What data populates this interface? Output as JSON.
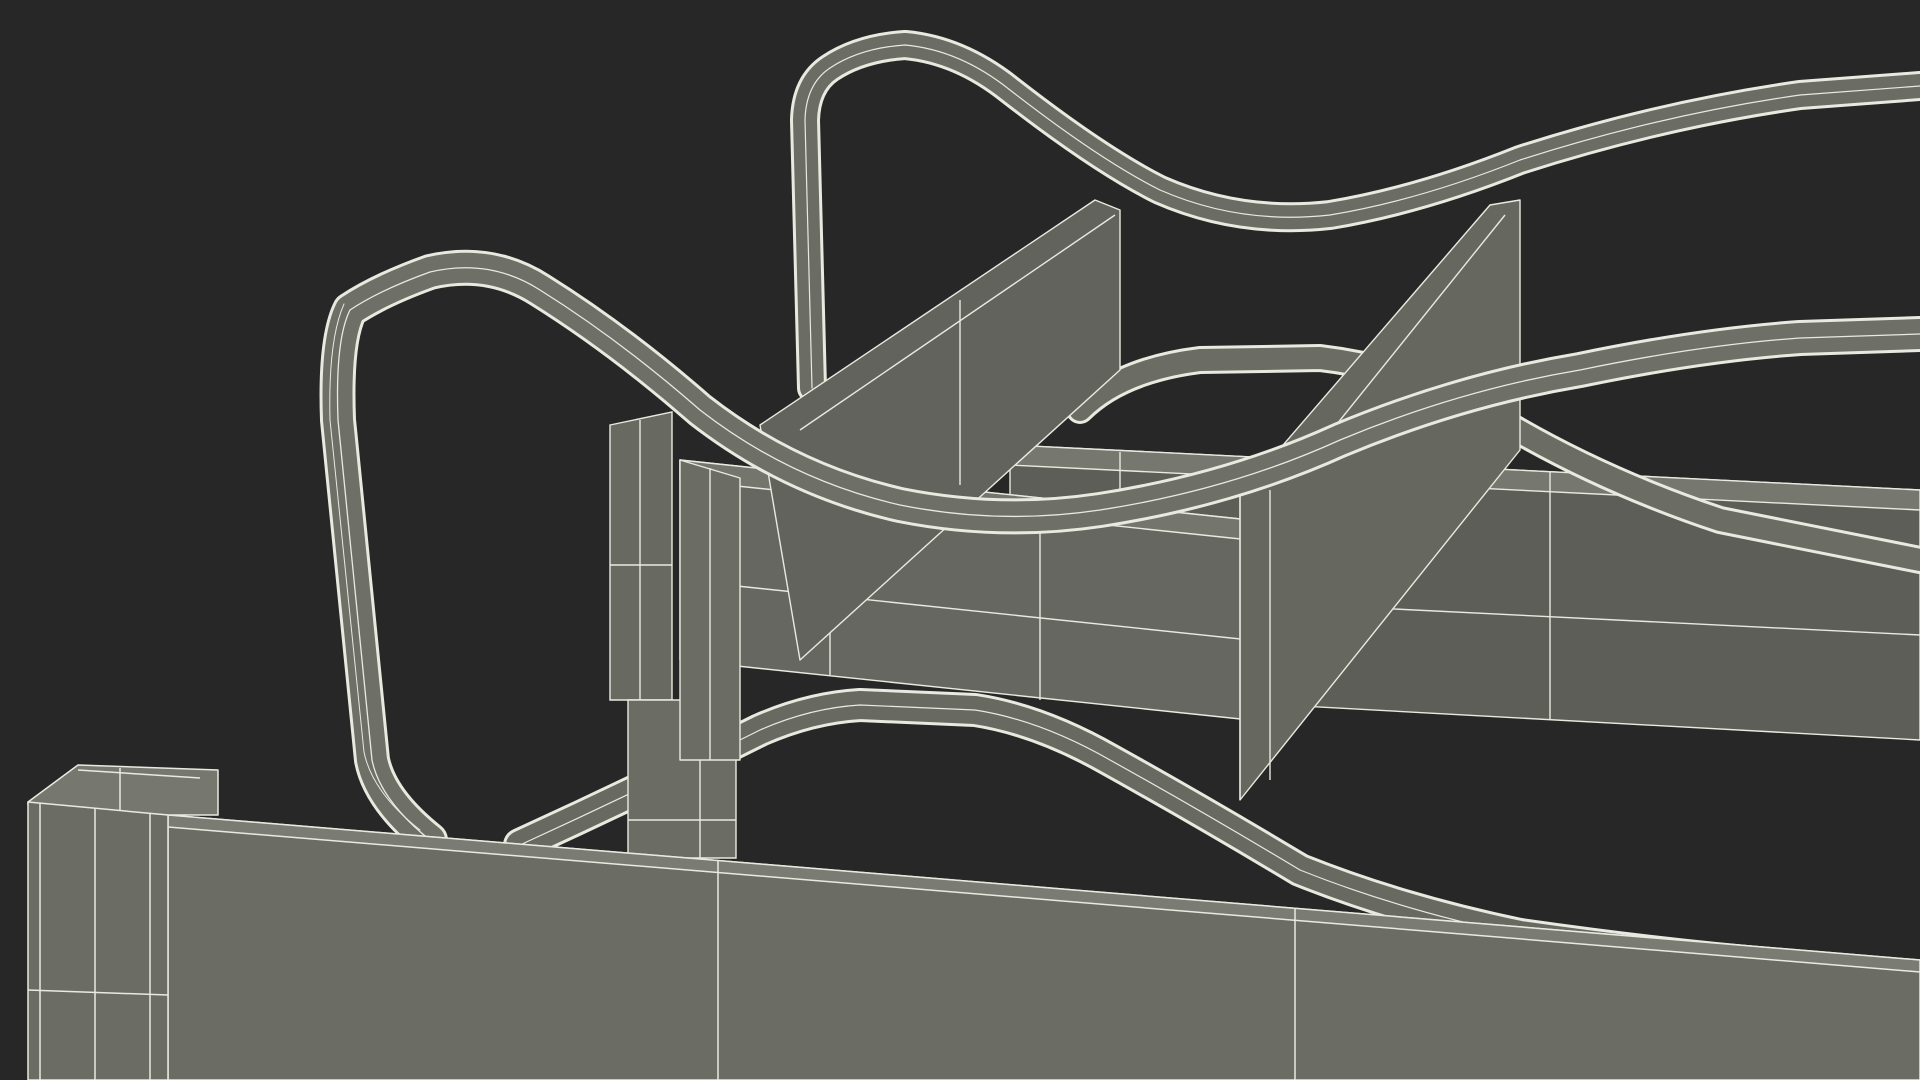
{
  "scene": {
    "background_color": "#272727",
    "surface_color": "#6b6c64",
    "surface_dark_color": "#5d5e57",
    "surface_light_color": "#76776e",
    "wire_color": "#e9eadf",
    "view_mode": "wireframe-on-shaded"
  }
}
